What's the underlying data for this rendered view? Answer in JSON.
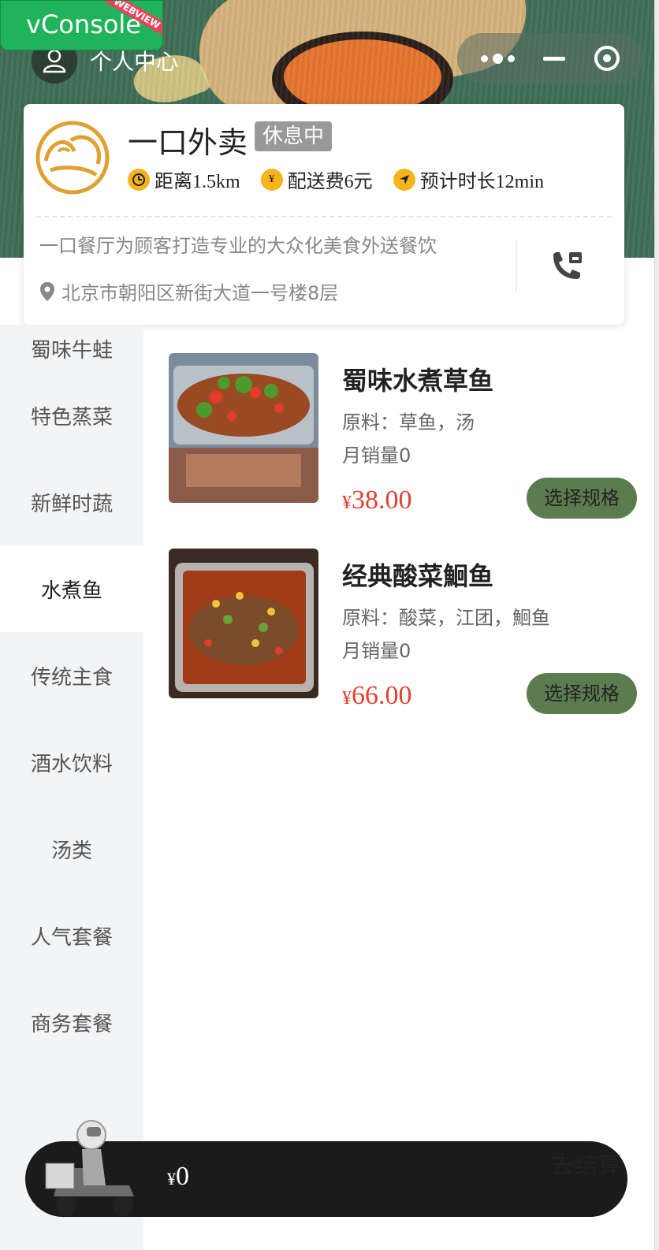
{
  "vconsole": {
    "label": "vConsole",
    "ribbon": "WEBVIEW"
  },
  "header": {
    "user_center_label": "个人中心"
  },
  "shop": {
    "name": "一口外卖",
    "status": "休息中",
    "distance": "距离1.5km",
    "delivery_fee": "配送费6元",
    "eta": "预计时长12min",
    "description": "一口餐厅为顾客打造专业的大众化美食外送餐饮",
    "address": "北京市朝阳区新街大道一号楼8层"
  },
  "categories": [
    {
      "label": "蜀味牛蛙",
      "active": false
    },
    {
      "label": "特色蒸菜",
      "active": false
    },
    {
      "label": "新鲜时蔬",
      "active": false
    },
    {
      "label": "水煮鱼",
      "active": true
    },
    {
      "label": "传统主食",
      "active": false
    },
    {
      "label": "酒水饮料",
      "active": false
    },
    {
      "label": "汤类",
      "active": false
    },
    {
      "label": "人气套餐",
      "active": false
    },
    {
      "label": "商务套餐",
      "active": false
    }
  ],
  "products": [
    {
      "name": "蜀味水煮草鱼",
      "ingredients": "原料：草鱼，汤",
      "monthly_sales": "月销量0",
      "currency": "¥",
      "price": "38.00",
      "button": "选择规格"
    },
    {
      "name": "经典酸菜鮰鱼",
      "ingredients": "原料：酸菜，江团，鮰鱼",
      "monthly_sales": "月销量0",
      "currency": "¥",
      "price": "66.00",
      "button": "选择规格"
    }
  ],
  "cart": {
    "currency": "¥",
    "total": "0",
    "checkout_label": "去结算"
  },
  "colors": {
    "accent_green": "#5b7c4e",
    "price_red": "#e2412f",
    "badge_gray": "#999999",
    "icon_yellow": "#f5b31c"
  }
}
